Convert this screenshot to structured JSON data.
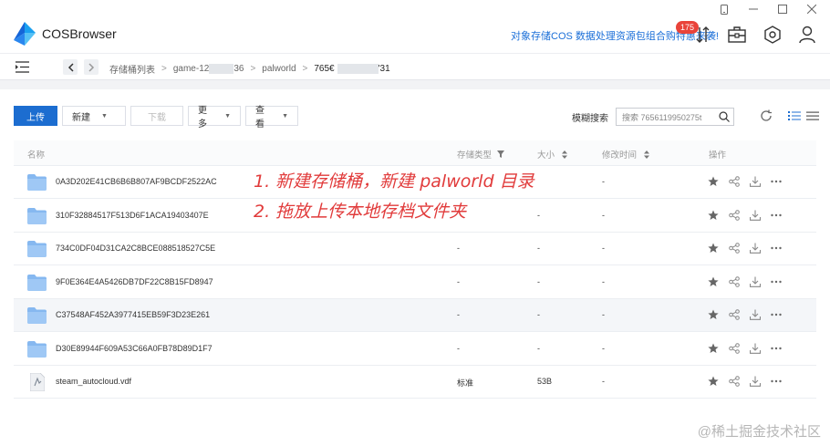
{
  "app": {
    "name": "COSBrowser"
  },
  "header": {
    "promo": "对象存储COS 数据处理资源包组合购特惠来袭!",
    "badge": "175"
  },
  "breadcrumb": {
    "items": [
      "存储桶列表",
      "game-12",
      "36",
      "palworld",
      "765€",
      "'31"
    ]
  },
  "toolbar": {
    "upload": "上传",
    "new": "新建",
    "download": "下载",
    "more": "更多",
    "view": "查看",
    "search_mode": "模糊搜索",
    "search_placeholder": "搜索 7656119950275t"
  },
  "table": {
    "headers": {
      "name": "名称",
      "type": "存储类型",
      "size": "大小",
      "time": "修改时间",
      "ops": "操作"
    },
    "rows": [
      {
        "name": "0A3D202E41CB6B6B807AF9BCDF2522AC",
        "type": "",
        "size": "",
        "time": "-",
        "kind": "folder"
      },
      {
        "name": "310F32884517F513D6F1ACA19403407E",
        "type": "",
        "size": "-",
        "time": "-",
        "kind": "folder"
      },
      {
        "name": "734C0DF04D31CA2C8BCE088518527C5E",
        "type": "-",
        "size": "-",
        "time": "-",
        "kind": "folder"
      },
      {
        "name": "9F0E364E4A5426DB7DF22C8B15FD8947",
        "type": "-",
        "size": "-",
        "time": "-",
        "kind": "folder"
      },
      {
        "name": "C37548AF452A3977415EB59F3D23E261",
        "type": "-",
        "size": "-",
        "time": "-",
        "kind": "folder"
      },
      {
        "name": "D30E89944F609A53C66A0FB78D89D1F7",
        "type": "-",
        "size": "-",
        "time": "-",
        "kind": "folder"
      },
      {
        "name": "steam_autocloud.vdf",
        "type": "标准",
        "size": "53B",
        "time": "-",
        "kind": "file"
      }
    ]
  },
  "annotations": {
    "line1": "1. 新建存储桶，新建 palworld 目录",
    "line2": "2. 拖放上传本地存档文件夹"
  },
  "watermark": "@稀土掘金技术社区",
  "colors": {
    "primary": "#1c6dd0",
    "annotation": "#e13b3b",
    "badge": "#e9433a"
  }
}
